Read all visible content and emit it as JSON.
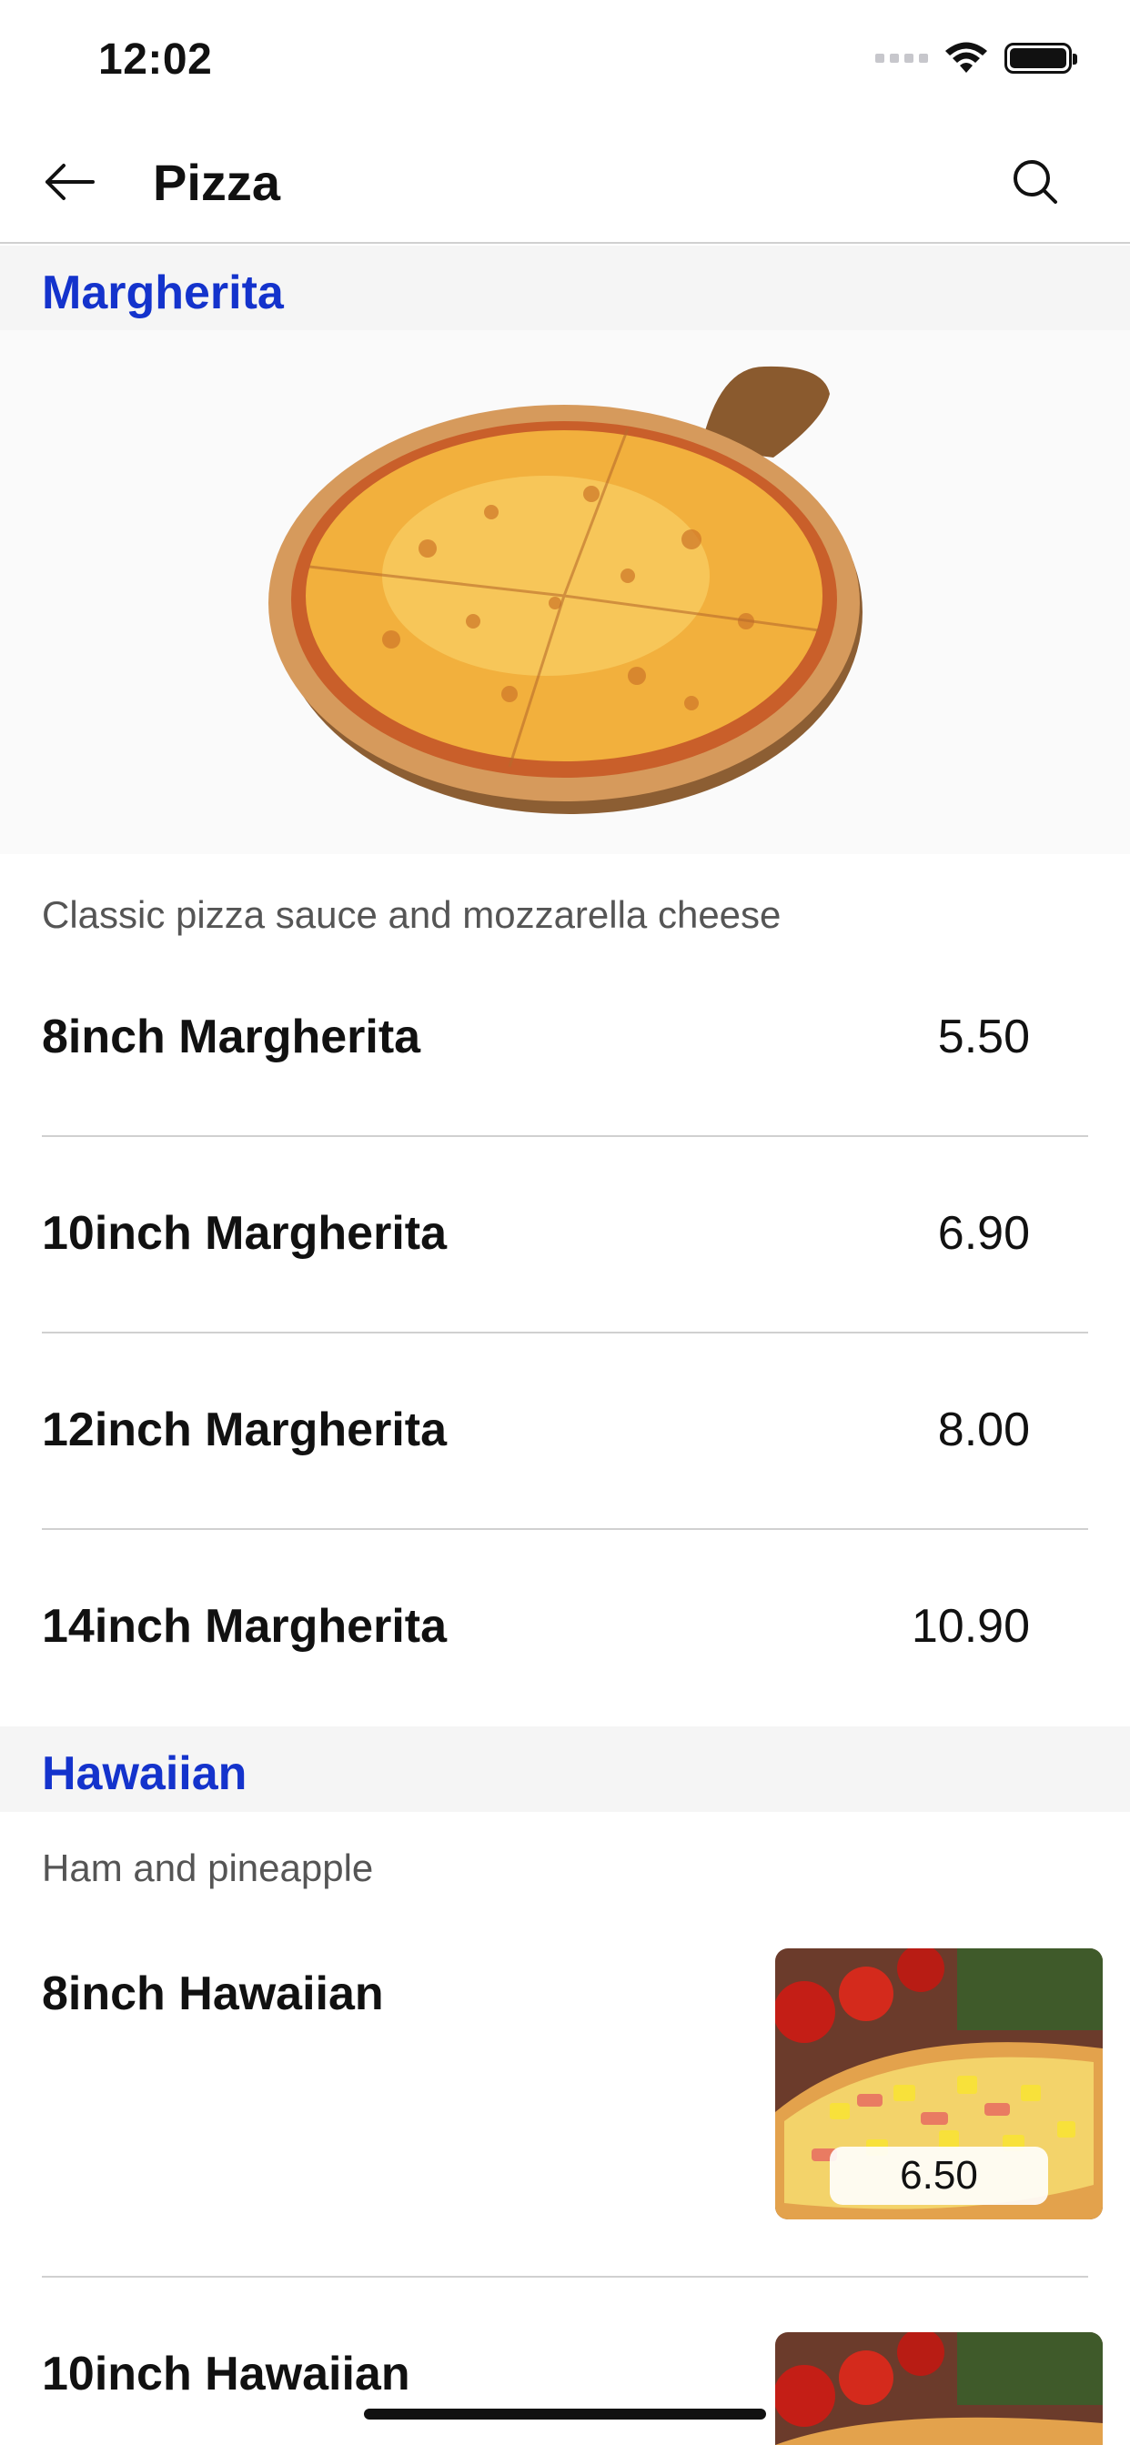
{
  "status_bar": {
    "time": "12:02"
  },
  "nav": {
    "title": "Pizza"
  },
  "colors": {
    "accent": "#1433cc",
    "section_bg": "#f5f5f5",
    "divider": "#d0d0d0"
  },
  "icons": {
    "back": "arrow-left-icon",
    "search": "search-icon",
    "wifi": "wifi-icon",
    "battery": "battery-icon"
  },
  "sections": [
    {
      "title": "Margherita",
      "description": "Classic pizza sauce and mozzarella cheese",
      "items": [
        {
          "name": "8inch Margherita",
          "price": "5.50"
        },
        {
          "name": "10inch Margherita",
          "price": "6.90"
        },
        {
          "name": "12inch Margherita",
          "price": "8.00"
        },
        {
          "name": "14inch Margherita",
          "price": "10.90"
        }
      ]
    },
    {
      "title": "Hawaiian",
      "description": "Ham and pineapple",
      "items": [
        {
          "name": "8inch Hawaiian",
          "price": "6.50"
        },
        {
          "name": "10inch Hawaiian"
        }
      ]
    }
  ]
}
